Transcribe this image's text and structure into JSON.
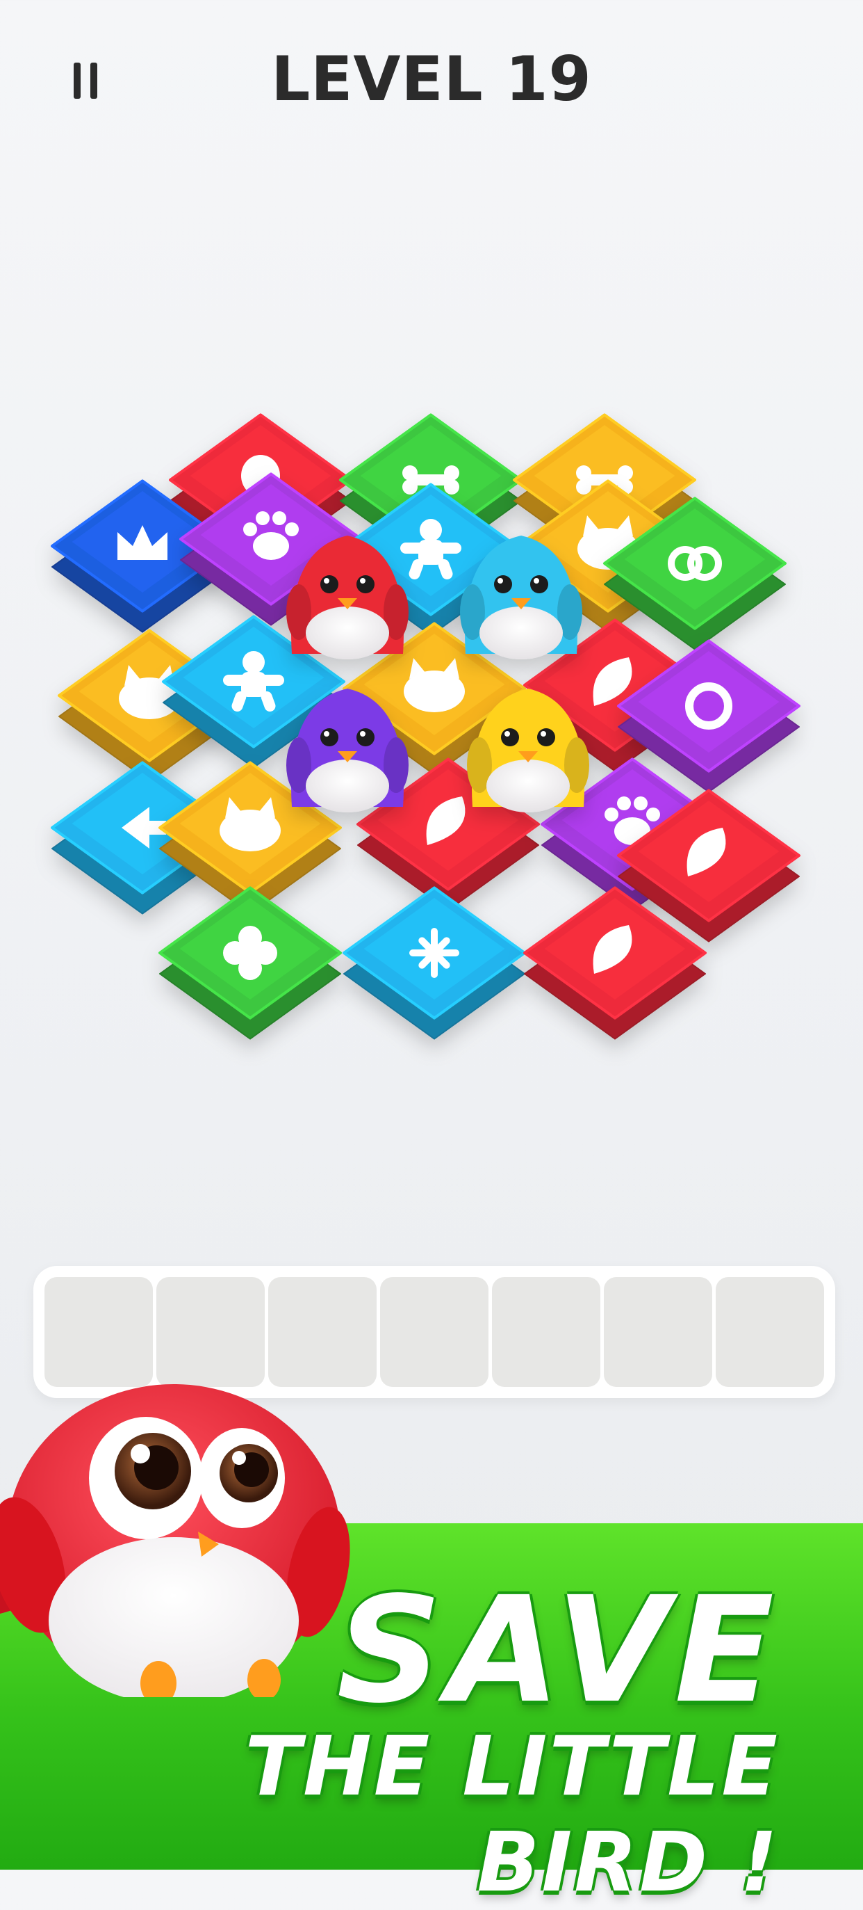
{
  "header": {
    "level_title": "LEVEL 19"
  },
  "tray": {
    "slot_count": 7,
    "filled": 0
  },
  "banner": {
    "headline": "SAVE",
    "subheadline": "THE LITTLE BIRD !"
  },
  "colors": {
    "red": "#ee2b3b",
    "blue": "#1f5ee0",
    "cyan": "#22b4ee",
    "orange": "#f6b21e",
    "green": "#3cc73f",
    "purple": "#a53ae0",
    "banner_green": "#3ccc1e"
  },
  "board": {
    "tiles": [
      {
        "color": "red",
        "icon": "balloon-icon"
      },
      {
        "color": "green",
        "icon": "bone-icon"
      },
      {
        "color": "orange",
        "icon": "bone-icon"
      },
      {
        "color": "blue",
        "icon": "crown-icon"
      },
      {
        "color": "purple",
        "icon": "paw-icon"
      },
      {
        "color": "cyan",
        "icon": "gingerbread-icon"
      },
      {
        "color": "orange",
        "icon": "cat-icon"
      },
      {
        "color": "green",
        "icon": "pretzel-icon"
      },
      {
        "color": "orange",
        "icon": "cat-icon"
      },
      {
        "color": "cyan",
        "icon": "gingerbread-icon"
      },
      {
        "color": "orange",
        "icon": "cat-icon"
      },
      {
        "color": "red",
        "icon": "leaf-icon"
      },
      {
        "color": "purple",
        "icon": "ring-icon"
      },
      {
        "color": "cyan",
        "icon": "arrow-icon"
      },
      {
        "color": "orange",
        "icon": "cat-icon"
      },
      {
        "color": "red",
        "icon": "leaf-icon"
      },
      {
        "color": "purple",
        "icon": "paw-icon"
      },
      {
        "color": "red",
        "icon": "leaf-icon"
      },
      {
        "color": "green",
        "icon": "flower-icon"
      },
      {
        "color": "cyan",
        "icon": "snowflake-icon"
      },
      {
        "color": "red",
        "icon": "leaf-icon"
      }
    ],
    "birds": [
      {
        "color": "red"
      },
      {
        "color": "cyan"
      },
      {
        "color": "purple"
      },
      {
        "color": "yellow"
      }
    ]
  }
}
